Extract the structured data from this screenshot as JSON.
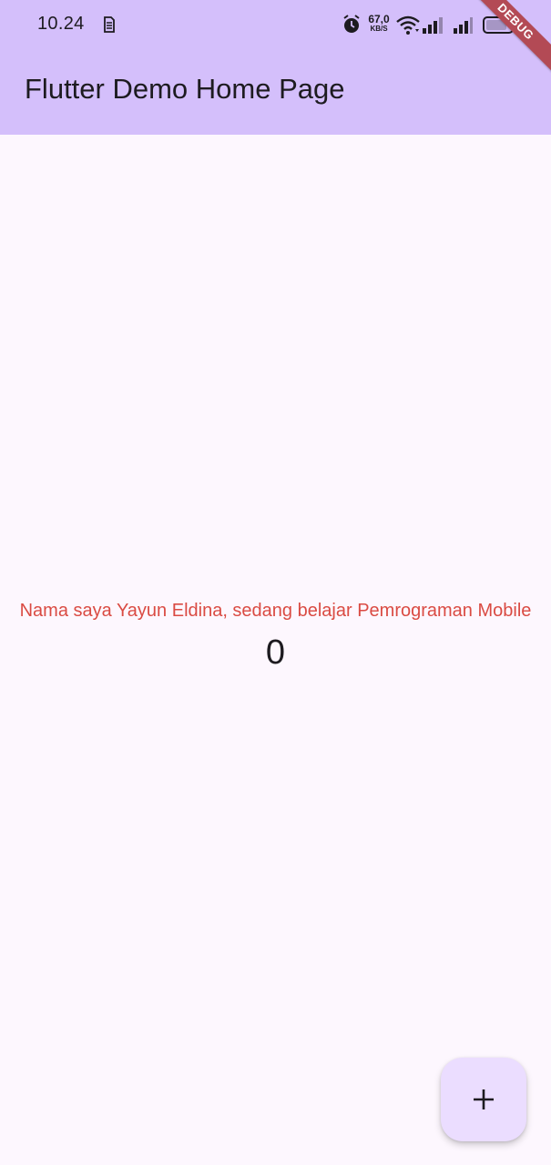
{
  "status_bar": {
    "time": "10.24",
    "network_speed_value": "67,0",
    "network_speed_unit": "KB/S",
    "icons": [
      "sim-icon",
      "alarm-icon",
      "wifi-icon",
      "signal-icon",
      "signal-icon",
      "battery-icon"
    ]
  },
  "app_bar": {
    "title": "Flutter Demo Home Page"
  },
  "debug_banner": {
    "label": "DEBUG"
  },
  "body": {
    "message": "Nama saya Yayun Eldina, sedang belajar Pemrograman Mobile",
    "counter": "0"
  },
  "fab": {
    "icon": "plus-icon"
  },
  "colors": {
    "app_bar": "#d4bffb",
    "background": "#fdf7fe",
    "message_text": "#da4b43",
    "fab": "#ebddff",
    "debug_banner": "#b34a55"
  }
}
